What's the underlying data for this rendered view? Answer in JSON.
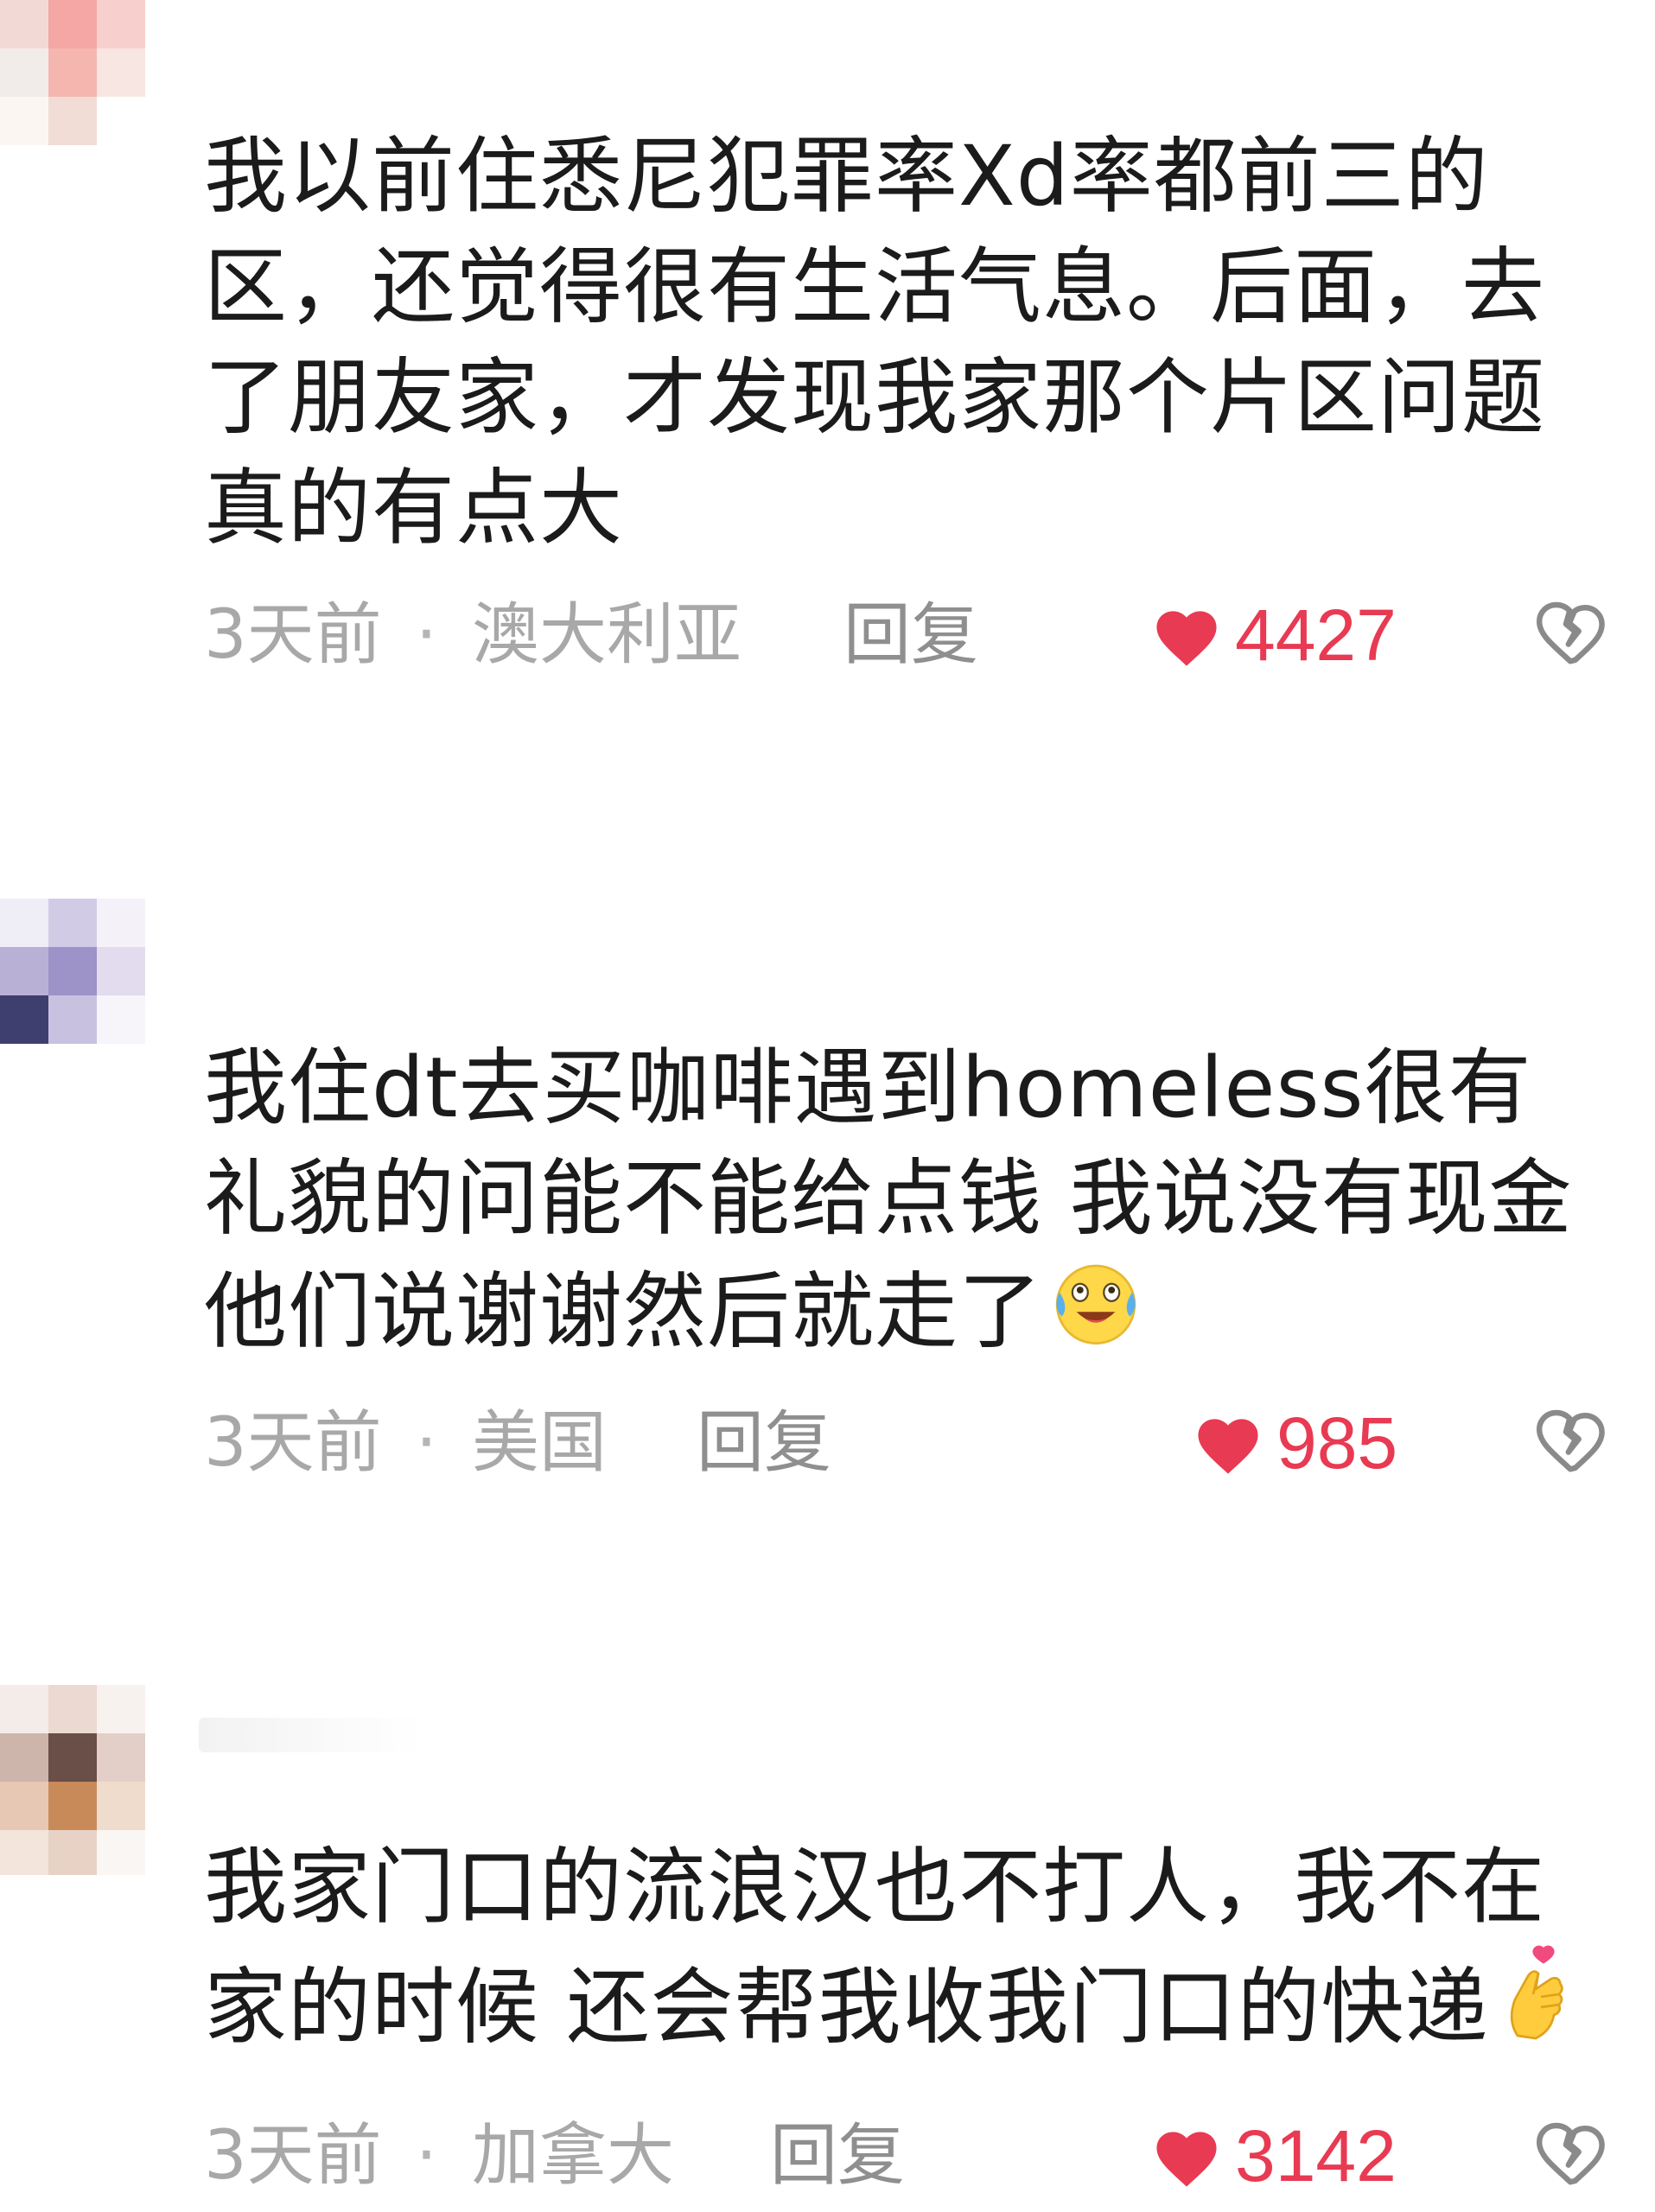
{
  "colors": {
    "like_red": "#e83a52",
    "meta_gray": "#a8a8a8",
    "text": "#1b1b1b"
  },
  "comments": [
    {
      "content": "我以前住悉尼犯罪率Xd率都前三的区，还觉得很有生活气息。后面，去了朋友家，才发现我家那个片区问题真的有点大",
      "time": "3天前",
      "separator": "·",
      "region": "澳大利亚",
      "reply_label": "回复",
      "likes": "4427",
      "like_icon": "heart-filled-icon",
      "dislike_icon": "broken-heart-icon"
    },
    {
      "content": "我住dt去买咖啡遇到homeless很有礼貌的问能不能给点钱 我说没有现金他们说谢谢然后就走了",
      "emoji": "tears-of-joy-emoji",
      "time": "3天前",
      "separator": "·",
      "region": "美国",
      "reply_label": "回复",
      "likes": "985",
      "like_icon": "heart-filled-icon",
      "dislike_icon": "broken-heart-icon"
    },
    {
      "content": "我家门口的流浪汉也不打人，我不在家的时候 还会帮我收我门口的快递",
      "emoji": "finger-heart-emoji",
      "time": "3天前",
      "separator": "·",
      "region": "加拿大",
      "reply_label": "回复",
      "likes": "3142",
      "like_icon": "heart-filled-icon",
      "dislike_icon": "broken-heart-icon"
    }
  ]
}
